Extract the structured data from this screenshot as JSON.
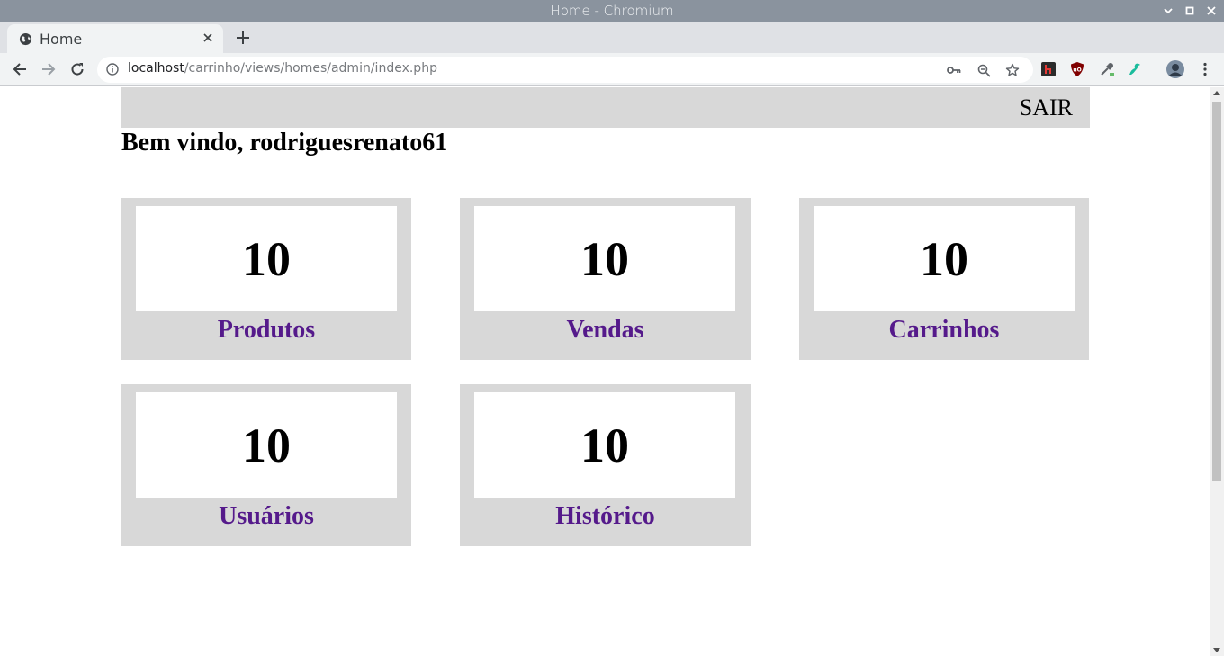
{
  "window": {
    "title": "Home - Chromium"
  },
  "tab": {
    "title": "Home"
  },
  "address_bar": {
    "host": "localhost",
    "path": "/carrinho/views/homes/admin/index.php"
  },
  "page": {
    "logout_label": "SAIR",
    "welcome": "Bem vindo, rodriguesrenato61",
    "cards": [
      {
        "count": "10",
        "label": "Produtos"
      },
      {
        "count": "10",
        "label": "Vendas"
      },
      {
        "count": "10",
        "label": "Carrinhos"
      },
      {
        "count": "10",
        "label": "Usuários"
      },
      {
        "count": "10",
        "label": "Histórico"
      }
    ]
  },
  "colors": {
    "titlebar": "#8a939e",
    "card_bg": "#d8d8d8",
    "link": "#551a8b"
  }
}
